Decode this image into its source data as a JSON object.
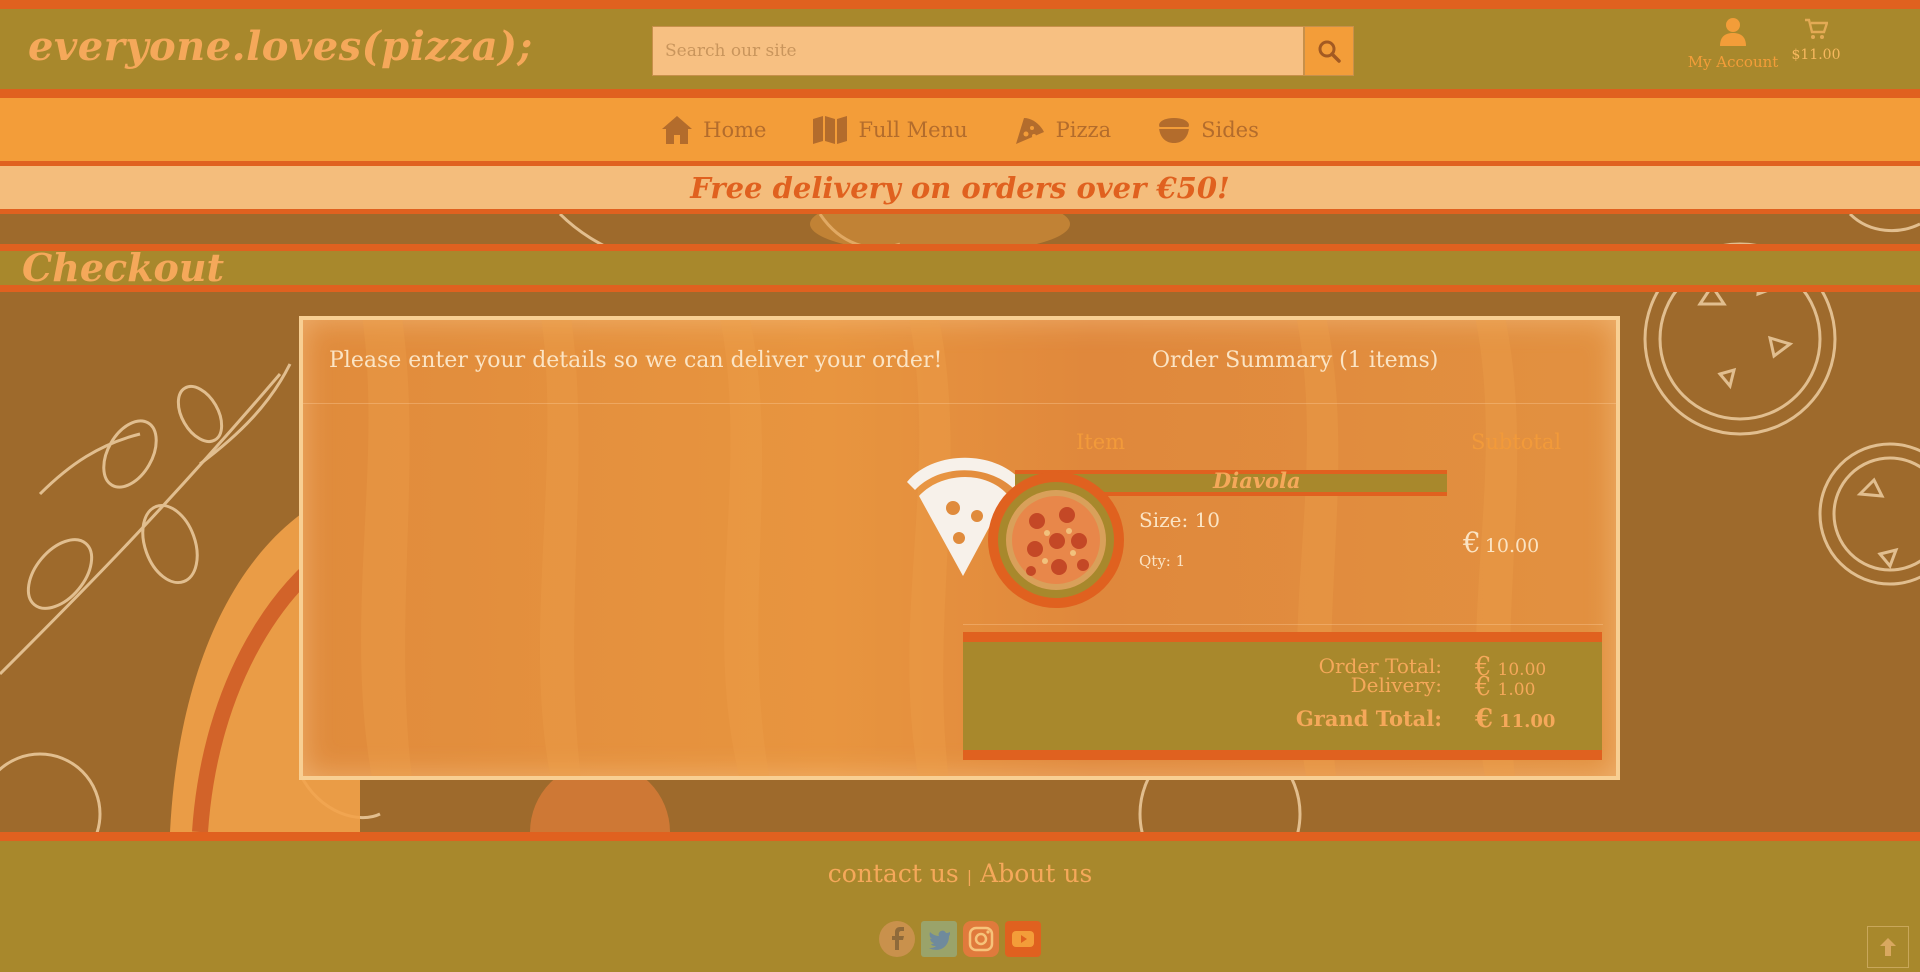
{
  "header": {
    "logo": "everyone.loves(pizza);",
    "search_placeholder": "Search our site",
    "account_label": "My Account",
    "cart_total": "$11.00"
  },
  "nav": {
    "items": [
      {
        "label": "Home",
        "icon": "home-icon"
      },
      {
        "label": "Full Menu",
        "icon": "map-icon"
      },
      {
        "label": "Pizza",
        "icon": "pizza-slice-icon"
      },
      {
        "label": "Sides",
        "icon": "bowl-icon"
      }
    ]
  },
  "promo": "Free delivery on orders over €50!",
  "page_title": "Checkout",
  "checkout": {
    "details_message": "Please enter your details so we can deliver your order!",
    "summary_title": "Order Summary (1 items)",
    "columns": {
      "item": "Item",
      "subtotal": "Subtotal"
    },
    "items": [
      {
        "name": "Diavola",
        "size_label": "Size: 10",
        "qty_label": "Qty: 1",
        "currency": "€",
        "subtotal": "10.00"
      }
    ],
    "totals": {
      "order_total_label": "Order Total:",
      "order_total": "10.00",
      "delivery_label": "Delivery:",
      "delivery": "1.00",
      "grand_total_label": "Grand Total:",
      "grand_total": "11.00",
      "currency": "€"
    }
  },
  "footer": {
    "contact": "contact us",
    "separator": "|",
    "about": "About us",
    "socials": [
      "facebook-icon",
      "twitter-icon",
      "instagram-icon",
      "youtube-icon"
    ]
  },
  "colors": {
    "accent_orange": "#e0611f",
    "olive": "#a8882c",
    "nav_orange": "#f39d39",
    "text_light": "#fbe4c4"
  }
}
